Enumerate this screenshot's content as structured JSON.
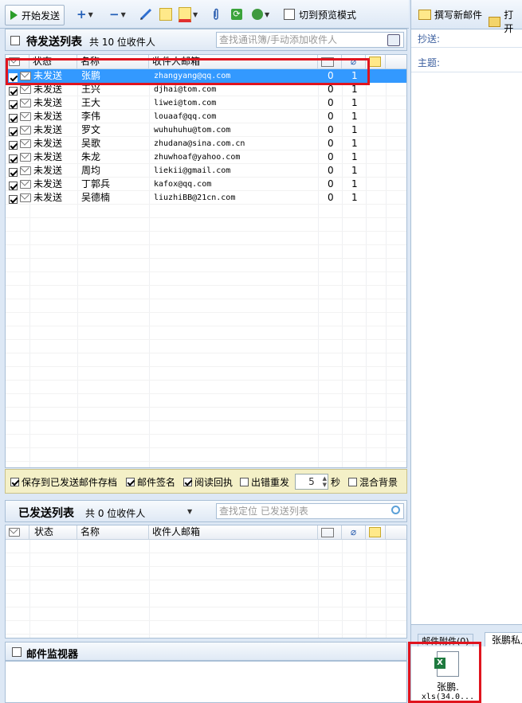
{
  "toolbar": {
    "start_send": "开始发送",
    "switch_preview": "切到预览模式"
  },
  "pending": {
    "title": "待发送列表",
    "count_text": "共 10 位收件人",
    "search_placeholder": "查找通讯簿/手动添加收件人",
    "columns": [
      "状态",
      "名称",
      "收件人邮箱"
    ],
    "rows": [
      {
        "status": "未发送",
        "name": "张鹏",
        "email": "zhangyang@qq.com",
        "c1": "0",
        "c2": "1"
      },
      {
        "status": "未发送",
        "name": "王兴",
        "email": "djhai@tom.com",
        "c1": "0",
        "c2": "1"
      },
      {
        "status": "未发送",
        "name": "王大",
        "email": "liwei@tom.com",
        "c1": "0",
        "c2": "1"
      },
      {
        "status": "未发送",
        "name": "李伟",
        "email": "louaaf@qq.com",
        "c1": "0",
        "c2": "1"
      },
      {
        "status": "未发送",
        "name": "罗文",
        "email": "wuhuhuhu@tom.com",
        "c1": "0",
        "c2": "1"
      },
      {
        "status": "未发送",
        "name": "吴歌",
        "email": "zhudana@sina.com.cn",
        "c1": "0",
        "c2": "1"
      },
      {
        "status": "未发送",
        "name": "朱龙",
        "email": "zhuwhoaf@yahoo.com",
        "c1": "0",
        "c2": "1"
      },
      {
        "status": "未发送",
        "name": "周均",
        "email": "liekii@gmail.com",
        "c1": "0",
        "c2": "1"
      },
      {
        "status": "未发送",
        "name": "丁郭兵",
        "email": "kafox@qq.com",
        "c1": "0",
        "c2": "1"
      },
      {
        "status": "未发送",
        "name": "吴德楠",
        "email": "liuzhiBB@21cn.com",
        "c1": "0",
        "c2": "1"
      }
    ]
  },
  "options": {
    "save_archive": "保存到已发送邮件存档",
    "signature": "邮件签名",
    "read_receipt": "阅读回执",
    "retry": "出错重发",
    "retry_value": "5",
    "retry_unit": "秒",
    "mixed_bg": "混合背景"
  },
  "sent": {
    "title": "已发送列表",
    "count_text": "共 0 位收件人",
    "search_placeholder": "查找定位 已发送列表",
    "columns": [
      "状态",
      "名称",
      "收件人邮箱"
    ]
  },
  "monitor": {
    "title": "邮件监视器"
  },
  "right": {
    "compose": "撰写新邮件",
    "open": "打开",
    "cc_label": "抄送:",
    "subject_label": "主题:",
    "tab_attach": "邮件附件(0)",
    "tab_private": "张鹏私人",
    "attachment_name": "张鹏.",
    "attachment_size": "xls(34.0..."
  }
}
